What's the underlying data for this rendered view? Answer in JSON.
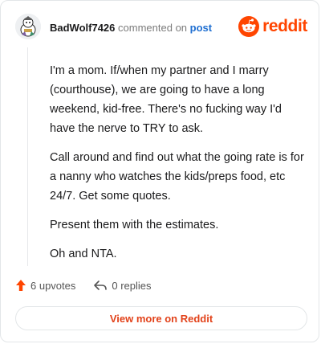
{
  "header": {
    "username": "BadWolf7426",
    "action_text": "commented on",
    "post_link": "post",
    "brand": "reddit",
    "brand_color": "#ff4500",
    "avatar_icon": "snoo-avatar-icon",
    "brand_icon": "reddit-snoo-icon"
  },
  "comment": {
    "paragraphs": [
      "I'm a mom. If/when my partner and I marry (courthouse), we are going to have a long weekend, kid-free. There's no fucking way I'd have the nerve to TRY to ask.",
      "Call around and find out what the going rate is for a nanny who watches the kids/preps food, etc 24/7. Get some quotes.",
      "Present them with the estimates.",
      "Oh and NTA."
    ]
  },
  "actions": {
    "upvotes": "6 upvotes",
    "replies": "0 replies",
    "upvote_icon": "upvote-arrow-icon",
    "reply_icon": "reply-arrow-icon",
    "upvote_color": "#ff4500"
  },
  "footer": {
    "view_label": "View more on Reddit",
    "accent": "#e2421a"
  }
}
